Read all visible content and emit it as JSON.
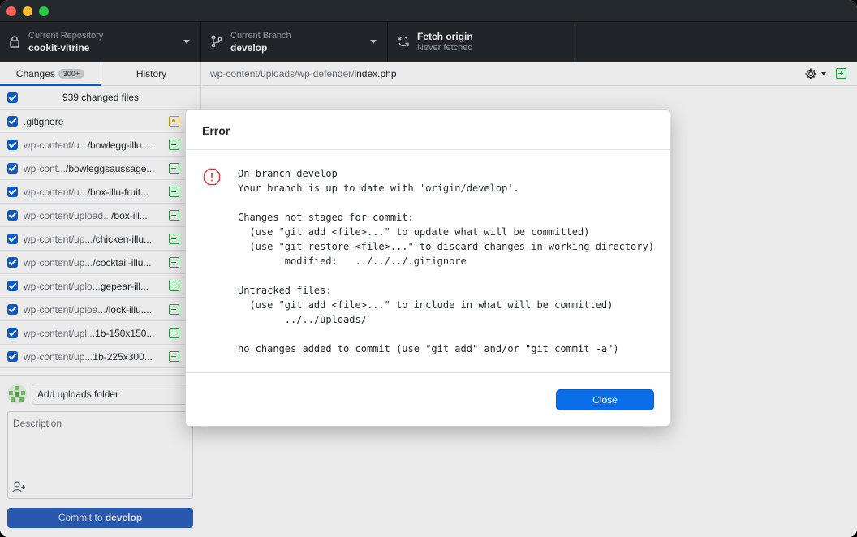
{
  "toolbar": {
    "repository": {
      "title": "Current Repository",
      "value": "cookit-vitrine"
    },
    "branch": {
      "title": "Current Branch",
      "value": "develop"
    },
    "fetch": {
      "title": "Fetch origin",
      "value": "Never fetched"
    }
  },
  "sidebar": {
    "tabs": [
      {
        "label": "Changes",
        "badge": "300+"
      },
      {
        "label": "History"
      }
    ],
    "changed_files_label": "939 changed files",
    "files": [
      {
        "dim": "",
        "name": ".gitignore",
        "status": "modified"
      },
      {
        "dim": "wp-content/u...",
        "name": "/bowlegg-illu....",
        "status": "added"
      },
      {
        "dim": "wp-cont...",
        "name": "/bowleggsaussage...",
        "status": "added"
      },
      {
        "dim": "wp-content/u...",
        "name": "/box-illu-fruit...",
        "status": "added"
      },
      {
        "dim": "wp-content/upload...",
        "name": "/box-ill...",
        "status": "added"
      },
      {
        "dim": "wp-content/up...",
        "name": "/chicken-illu...",
        "status": "added"
      },
      {
        "dim": "wp-content/up...",
        "name": "/cocktail-illu...",
        "status": "added"
      },
      {
        "dim": "wp-content/uplo...",
        "name": "gepear-ill...",
        "status": "added"
      },
      {
        "dim": "wp-content/uploa...",
        "name": "/lock-illu....",
        "status": "added"
      },
      {
        "dim": "wp-content/upl...",
        "name": "1b-150x150...",
        "status": "added"
      },
      {
        "dim": "wp-content/up...",
        "name": "1b-225x300...",
        "status": "added"
      }
    ],
    "commit": {
      "summary": "Add uploads folder",
      "description_placeholder": "Description",
      "button_prefix": "Commit to ",
      "button_branch": "develop"
    }
  },
  "main": {
    "path_dim": "wp-content/uploads/wp-defender/",
    "path_file": "index.php"
  },
  "dialog": {
    "title": "Error",
    "message": "On branch develop\nYour branch is up to date with 'origin/develop'.\n\nChanges not staged for commit:\n  (use \"git add <file>...\" to update what will be committed)\n  (use \"git restore <file>...\" to discard changes in working directory)\n        modified:   ../../../.gitignore\n\nUntracked files:\n  (use \"git add <file>...\" to include in what will be committed)\n        ../../uploads/\n\nno changes added to commit (use \"git add\" and/or \"git commit -a\")",
    "close_label": "Close"
  },
  "colors": {
    "accent": "#0a6ee8",
    "commit_button": "#2c5fbd",
    "added": "#28a745",
    "modified": "#dba00a",
    "error": "#d73a49",
    "toolbar_bg": "#24292e"
  },
  "icons": {
    "repository": "lock-icon",
    "branch": "git-branch-icon",
    "fetch": "sync-icon",
    "settings": "gear-icon",
    "error": "alert-octagon-icon",
    "coauthor": "person-add-icon"
  }
}
